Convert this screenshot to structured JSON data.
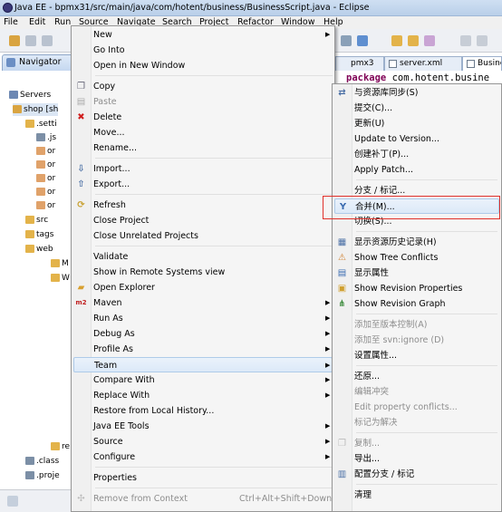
{
  "window": {
    "title": "Java EE - bpmx31/src/main/java/com/hotent/business/BusinessScript.java - Eclipse"
  },
  "menubar": [
    "File",
    "Edit",
    "Run",
    "Source",
    "Navigate",
    "Search",
    "Project",
    "Refactor",
    "Window",
    "Help"
  ],
  "navigator": {
    "tab_label": "Navigator",
    "tree": [
      {
        "label": "Servers"
      },
      {
        "label": "shop [sh"
      },
      {
        "label": ".setti"
      },
      {
        "label": ".js"
      },
      {
        "label": "or"
      },
      {
        "label": "or"
      },
      {
        "label": "or"
      },
      {
        "label": "or"
      },
      {
        "label": "or"
      },
      {
        "label": "src"
      },
      {
        "label": "tags"
      },
      {
        "label": "web"
      },
      {
        "label": "M"
      },
      {
        "label": "W"
      },
      {
        "label": "re"
      },
      {
        "label": ".class"
      },
      {
        "label": ".proje"
      }
    ]
  },
  "editor": {
    "tabs": [
      "pmx3",
      "server.xml",
      "Busine"
    ],
    "code_keyword": "package",
    "code_text": " com.hotent.busine"
  },
  "context_menu": {
    "items": [
      {
        "label": "New",
        "arrow": true
      },
      {
        "label": "Go Into"
      },
      {
        "label": "Open in New Window"
      },
      {
        "sep": true
      },
      {
        "label": "Copy",
        "icon": "copy-icon"
      },
      {
        "label": "Paste",
        "icon": "paste-icon",
        "disabled": true
      },
      {
        "label": "Delete",
        "icon": "delete-icon"
      },
      {
        "label": "Move..."
      },
      {
        "label": "Rename..."
      },
      {
        "sep": true
      },
      {
        "label": "Import...",
        "icon": "import-icon"
      },
      {
        "label": "Export...",
        "icon": "export-icon"
      },
      {
        "sep": true
      },
      {
        "label": "Refresh",
        "icon": "refresh-icon"
      },
      {
        "label": "Close Project"
      },
      {
        "label": "Close Unrelated Projects"
      },
      {
        "sep": true
      },
      {
        "label": "Validate"
      },
      {
        "label": "Show in Remote Systems view"
      },
      {
        "label": "Open Explorer",
        "icon": "explorer-icon"
      },
      {
        "label": "Maven",
        "icon": "maven-icon",
        "arrow": true
      },
      {
        "label": "Run As",
        "arrow": true
      },
      {
        "label": "Debug As",
        "arrow": true
      },
      {
        "label": "Profile As",
        "arrow": true
      },
      {
        "label": "Team",
        "arrow": true,
        "highlight": true
      },
      {
        "label": "Compare With",
        "arrow": true
      },
      {
        "label": "Replace With",
        "arrow": true
      },
      {
        "label": "Restore from Local History..."
      },
      {
        "label": "Java EE Tools",
        "arrow": true
      },
      {
        "label": "Source",
        "arrow": true
      },
      {
        "label": "Configure",
        "arrow": true
      },
      {
        "sep": true
      },
      {
        "label": "Properties"
      },
      {
        "sep": true
      },
      {
        "label": "Remove from Context",
        "icon": "remove-context-icon",
        "disabled": true,
        "accel": "Ctrl+Alt+Shift+Down"
      }
    ]
  },
  "team_submenu": {
    "items": [
      {
        "label": "与资源库同步(S)",
        "icon": "sync-icon"
      },
      {
        "label": "提交(C)..."
      },
      {
        "label": "更新(U)"
      },
      {
        "label": "Update to Version..."
      },
      {
        "label": "创建补丁(P)..."
      },
      {
        "label": "Apply Patch..."
      },
      {
        "sep": true
      },
      {
        "label": "分支 / 标记..."
      },
      {
        "label": "合并(M)...",
        "icon": "merge-icon",
        "highlight": true
      },
      {
        "label": "切换(S)..."
      },
      {
        "sep": true
      },
      {
        "label": "显示资源历史记录(H)",
        "icon": "history-icon"
      },
      {
        "label": "Show Tree Conflicts",
        "icon": "tree-conflicts-icon"
      },
      {
        "label": "显示属性",
        "icon": "properties-icon"
      },
      {
        "label": "Show Revision Properties",
        "icon": "revision-properties-icon"
      },
      {
        "label": "Show Revision Graph",
        "icon": "revision-graph-icon"
      },
      {
        "sep": true
      },
      {
        "label": "添加至版本控制(A)",
        "disabled": true
      },
      {
        "label": "添加至 svn:ignore (D)",
        "disabled": true
      },
      {
        "label": "设置属性..."
      },
      {
        "sep": true
      },
      {
        "label": "还原..."
      },
      {
        "label": "编辑冲突",
        "disabled": true
      },
      {
        "label": "Edit property conflicts...",
        "disabled": true
      },
      {
        "label": "标记为解决",
        "disabled": true
      },
      {
        "sep": true
      },
      {
        "label": "复制...",
        "icon": "svn-copy-icon",
        "disabled": true
      },
      {
        "label": "导出..."
      },
      {
        "label": "配置分支 / 标记",
        "icon": "config-branch-icon"
      },
      {
        "sep": true
      },
      {
        "label": "清理"
      }
    ]
  },
  "colors": {
    "highlight_border": "#e0302a",
    "menu_bg": "#f5f5f5"
  }
}
